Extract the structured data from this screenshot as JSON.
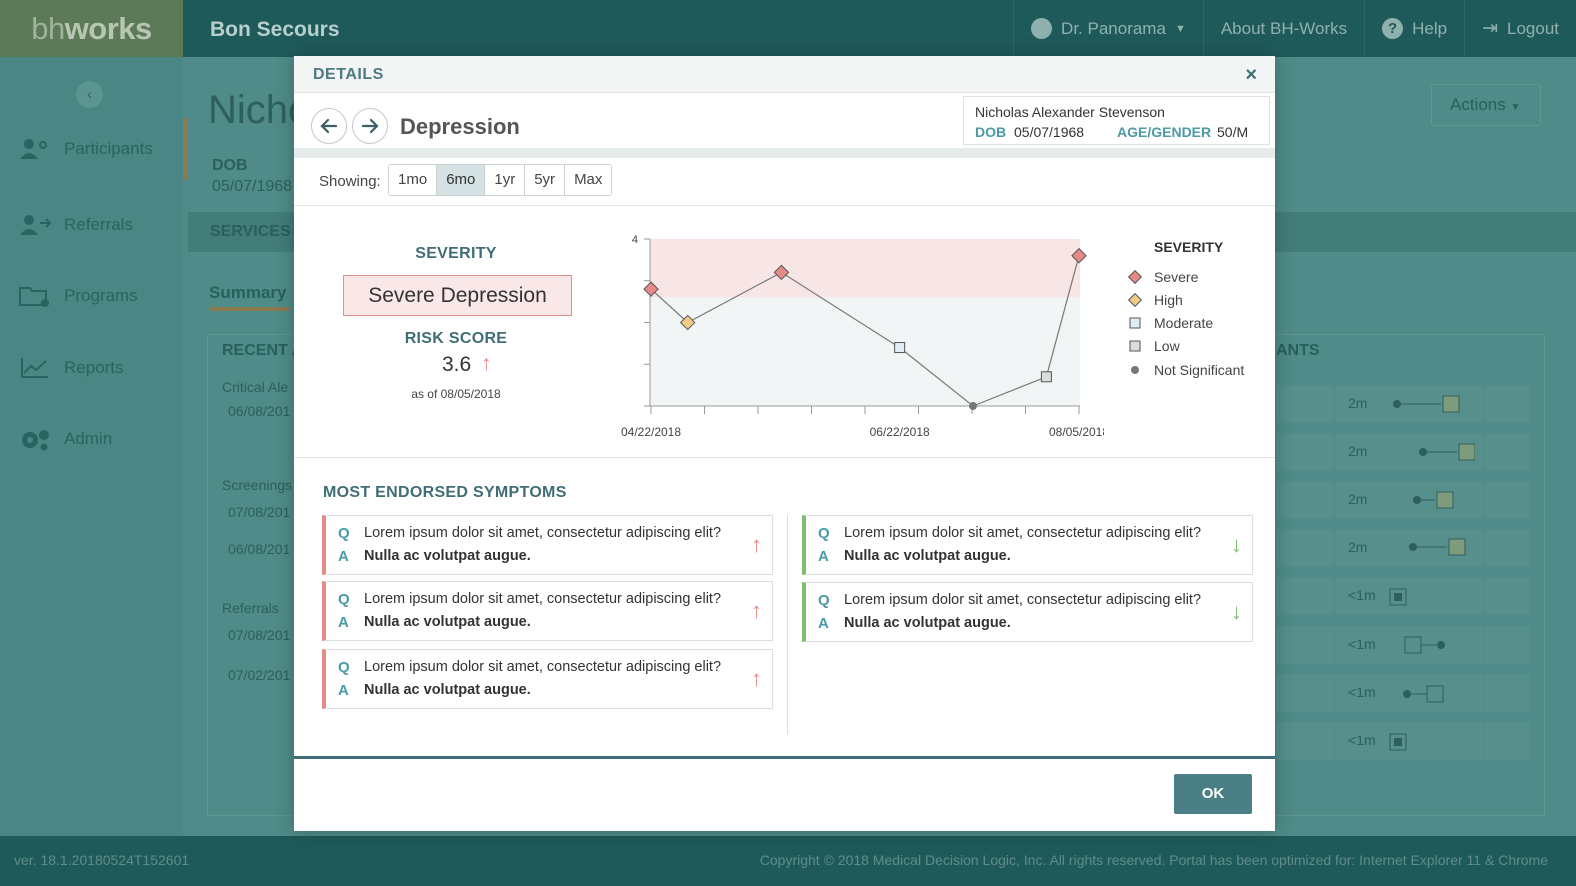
{
  "app": {
    "logo_part1": "bh",
    "logo_part2": "works",
    "org": "Bon Secours",
    "nav": {
      "user": "Dr. Panorama",
      "about": "About BH-Works",
      "help": "Help",
      "logout": "Logout"
    }
  },
  "sidebar": {
    "items": [
      {
        "label": "Participants",
        "icon": "participants-icon"
      },
      {
        "label": "Referrals",
        "icon": "referrals-icon"
      },
      {
        "label": "Programs",
        "icon": "programs-icon"
      },
      {
        "label": "Reports",
        "icon": "reports-icon"
      },
      {
        "label": "Admin",
        "icon": "admin-icon"
      }
    ]
  },
  "background": {
    "title": "Nicho",
    "dob_label": "DOB",
    "dob_value": "05/07/1968",
    "services": "SERVICES",
    "summary_tab": "Summary",
    "actions": "Actions",
    "recent": "RECENT A",
    "ants": "ANTS",
    "critical": "Critical Ale",
    "critical_date": "06/08/201",
    "screenings": "Screenings",
    "screen_date1": "07/08/201",
    "screen_date2": "06/08/201",
    "referrals": "Referrals",
    "ref_date1": "07/08/201",
    "ref_date2": "07/02/201",
    "rows": [
      "2m",
      "2m",
      "2m",
      "2m",
      "<1m",
      "<1m",
      "<1m",
      "<1m"
    ]
  },
  "footer": {
    "version": "ver. 18.1.20180524T152601",
    "copyright": "Copyright © 2018 Medical Decision Logic, Inc. All rights reserved. Portal has been optimized for: Internet Explorer 11 & Chrome"
  },
  "modal": {
    "title": "DETAILS",
    "close": "×",
    "measure": "Depression",
    "patient": {
      "name": "Nicholas Alexander Stevenson",
      "dob_label": "DOB",
      "dob": "05/07/1968",
      "age_gender_label": "AGE/GENDER",
      "age_gender": "50/M"
    },
    "showing_label": "Showing:",
    "ranges": [
      "1mo",
      "6mo",
      "1yr",
      "5yr",
      "Max"
    ],
    "active_range": "6mo",
    "severity_label": "SEVERITY",
    "severity_value": "Severe Depression",
    "risk_label": "RISK SCORE",
    "risk_value": "3.6",
    "risk_trend": "up",
    "as_of": "as of 08/05/2018",
    "legend_title": "SEVERITY",
    "legend": [
      {
        "label": "Severe",
        "marker": "diamond",
        "color": "#e58a86"
      },
      {
        "label": "High",
        "marker": "diamond",
        "color": "#f0cc86"
      },
      {
        "label": "Moderate",
        "marker": "square",
        "color": "#dfeef5"
      },
      {
        "label": "Low",
        "marker": "square",
        "color": "#dcdcdc"
      },
      {
        "label": "Not Significant",
        "marker": "circle",
        "color": "#777777"
      }
    ],
    "symptoms_title": "MOST ENDORSED SYMPTOMS",
    "symptoms_left": [
      {
        "q": "Lorem ipsum dolor sit amet, consectetur adipiscing elit?",
        "a": "Nulla ac volutpat augue.",
        "trend": "up"
      },
      {
        "q": "Lorem ipsum dolor sit amet, consectetur adipiscing elit?",
        "a": "Nulla ac volutpat augue.",
        "trend": "up"
      },
      {
        "q": "Lorem ipsum dolor sit amet, consectetur adipiscing elit?",
        "a": "Nulla ac volutpat augue.",
        "trend": "up"
      }
    ],
    "symptoms_right": [
      {
        "q": "Lorem ipsum dolor sit amet, consectetur adipiscing elit?",
        "a": "Nulla ac volutpat augue.",
        "trend": "down"
      },
      {
        "q": "Lorem ipsum dolor sit amet, consectetur adipiscing elit?",
        "a": "Nulla ac volutpat augue.",
        "trend": "down"
      }
    ],
    "q_letter": "Q",
    "a_letter": "A",
    "ok": "OK"
  },
  "chart_data": {
    "type": "line",
    "title": "",
    "xlabel": "",
    "ylabel": "",
    "ylim": [
      0,
      4
    ],
    "ytick_labels": [
      "4"
    ],
    "xtick_labels": [
      "04/22/2018",
      "06/22/2018",
      "08/05/2018"
    ],
    "severe_band": [
      2.6,
      4
    ],
    "points": [
      {
        "x": "04/22/2018",
        "y": 2.8,
        "severity": "Severe"
      },
      {
        "x": "05/01/2018",
        "y": 2.0,
        "severity": "High"
      },
      {
        "x": "05/24/2018",
        "y": 3.2,
        "severity": "Severe"
      },
      {
        "x": "06/22/2018",
        "y": 1.4,
        "severity": "Moderate"
      },
      {
        "x": "07/10/2018",
        "y": 0.0,
        "severity": "Not Significant"
      },
      {
        "x": "07/28/2018",
        "y": 0.7,
        "severity": "Low"
      },
      {
        "x": "08/05/2018",
        "y": 3.6,
        "severity": "Severe"
      }
    ]
  }
}
